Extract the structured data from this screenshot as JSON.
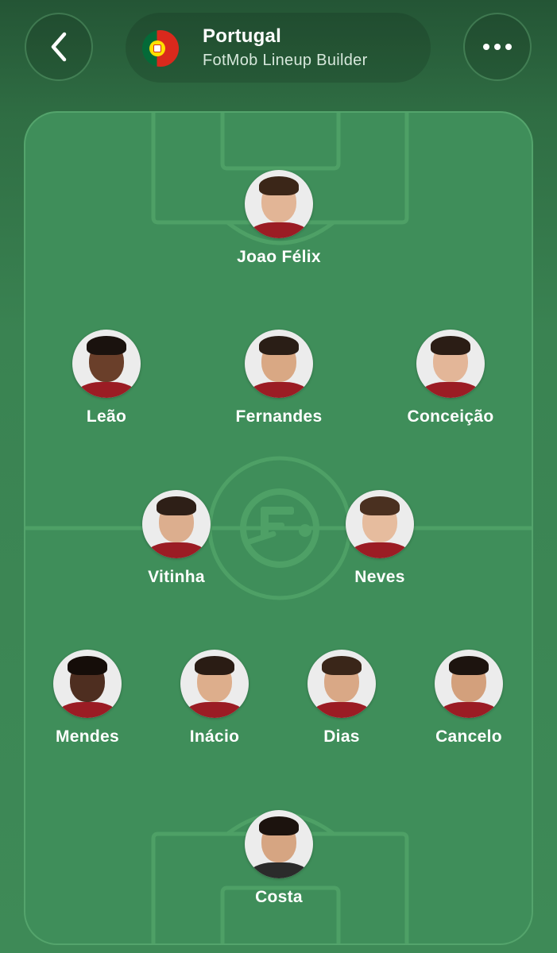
{
  "header": {
    "back_icon": "chevron-left-icon",
    "more_icon": "more-dots-icon",
    "team_name": "Portugal",
    "subtitle": "FotMob Lineup Builder",
    "flag_icon": "portugal-flag-icon"
  },
  "colors": {
    "pitch": "#3f8e5a",
    "pitch_lines": "#4ea066",
    "background_top": "#245535",
    "accent": "#ffffff"
  },
  "lineup": {
    "forward": [
      {
        "name": "Joao Félix"
      }
    ],
    "attacking_mid": [
      {
        "name": "Leão"
      },
      {
        "name": "Fernandes"
      },
      {
        "name": "Conceição"
      }
    ],
    "central_mid": [
      {
        "name": "Vitinha"
      },
      {
        "name": "Neves"
      }
    ],
    "defence": [
      {
        "name": "Mendes"
      },
      {
        "name": "Inácio"
      },
      {
        "name": "Dias"
      },
      {
        "name": "Cancelo"
      }
    ],
    "goalkeeper": [
      {
        "name": "Costa"
      }
    ]
  }
}
